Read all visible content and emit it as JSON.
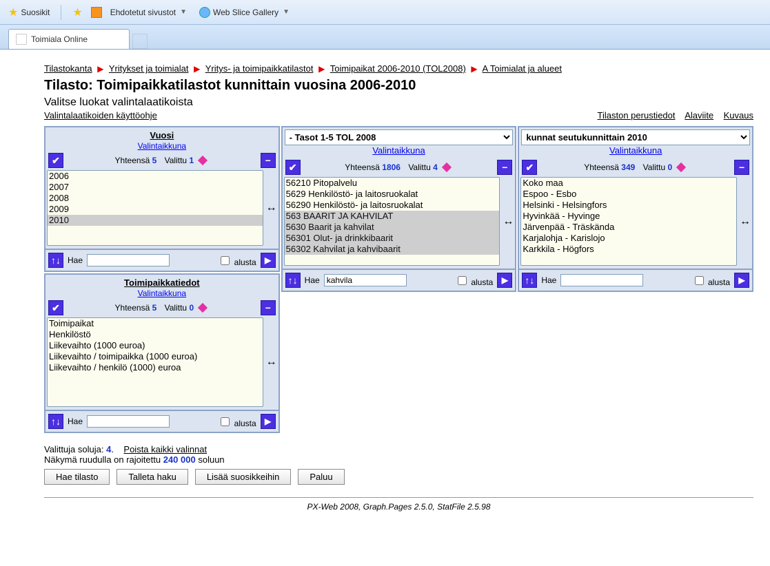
{
  "browser": {
    "favorites": "Suosikit",
    "suggested": "Ehdotetut sivustot",
    "webslice": "Web Slice Gallery",
    "tab": "Toimiala Online"
  },
  "breadcrumb": [
    "Tilastokanta",
    "Yritykset ja toimialat",
    "Yritys- ja toimipaikkatilastot",
    "Toimipaikat 2006-2010 (TOL2008)",
    "A Toimialat ja alueet"
  ],
  "title": "Tilasto: Toimipaikkatilastot kunnittain vuosina 2006-2010",
  "subtitle": "Valitse luokat valintalaatikoista",
  "help_link": "Valintalaatikoiden käyttöohje",
  "top_links": {
    "a": "Tilaston perustiedot",
    "b": "Alaviite",
    "c": "Kuvaus"
  },
  "labels": {
    "valintaikkuna": "Valintaikkuna",
    "yhteensa": "Yhteensä",
    "valittu": "Valittu",
    "hae": "Hae",
    "alusta": "alusta"
  },
  "panel_vuosi": {
    "title": "Vuosi",
    "total": "5",
    "selected": "1",
    "items": [
      "2006",
      "2007",
      "2008",
      "2009",
      "2010"
    ],
    "search": ""
  },
  "panel_tasot": {
    "dropdown": "- Tasot 1-5 TOL 2008",
    "total": "1806",
    "selected": "4",
    "items": [
      "56210 Pitopalvelu",
      "5629 Henkilöstö- ja laitosruokalat",
      "56290 Henkilöstö- ja laitosruokalat",
      "563 BAARIT JA KAHVILAT",
      "5630 Baarit ja kahvilat",
      "56301 Olut- ja drinkkibaarit",
      "56302 Kahvilat ja kahvibaarit"
    ],
    "search": "kahvila"
  },
  "panel_kunnat": {
    "dropdown": "kunnat seutukunnittain 2010",
    "total": "349",
    "selected": "0",
    "items": [
      "Koko maa",
      "Espoo - Esbo",
      "Helsinki - Helsingfors",
      "Hyvinkää - Hyvinge",
      "Järvenpää - Träskända",
      "Karjalohja - Karislojo",
      "Karkkila - Högfors"
    ],
    "search": ""
  },
  "panel_tiedot": {
    "title": "Toimipaikkatiedot",
    "total": "5",
    "selected": "0",
    "items": [
      "Toimipaikat",
      "Henkilöstö",
      "Liikevaihto (1000 euroa)",
      "Liikevaihto / toimipaikka (1000 euroa)",
      "Liikevaihto / henkilö (1000) euroa"
    ],
    "search": ""
  },
  "footer": {
    "sel_label": "Valittuja soluja:",
    "sel_count": "4",
    "clear": "Poista kaikki valinnat",
    "limit_pre": "Näkymä ruudulla on rajoitettu",
    "limit_n": "240 000",
    "limit_post": "soluun",
    "btn1": "Hae tilasto",
    "btn2": "Talleta haku",
    "btn3": "Lisää suosikkeihin",
    "btn4": "Paluu"
  },
  "credits": "PX-Web 2008, Graph.Pages 2.5.0, StatFile 2.5.98"
}
